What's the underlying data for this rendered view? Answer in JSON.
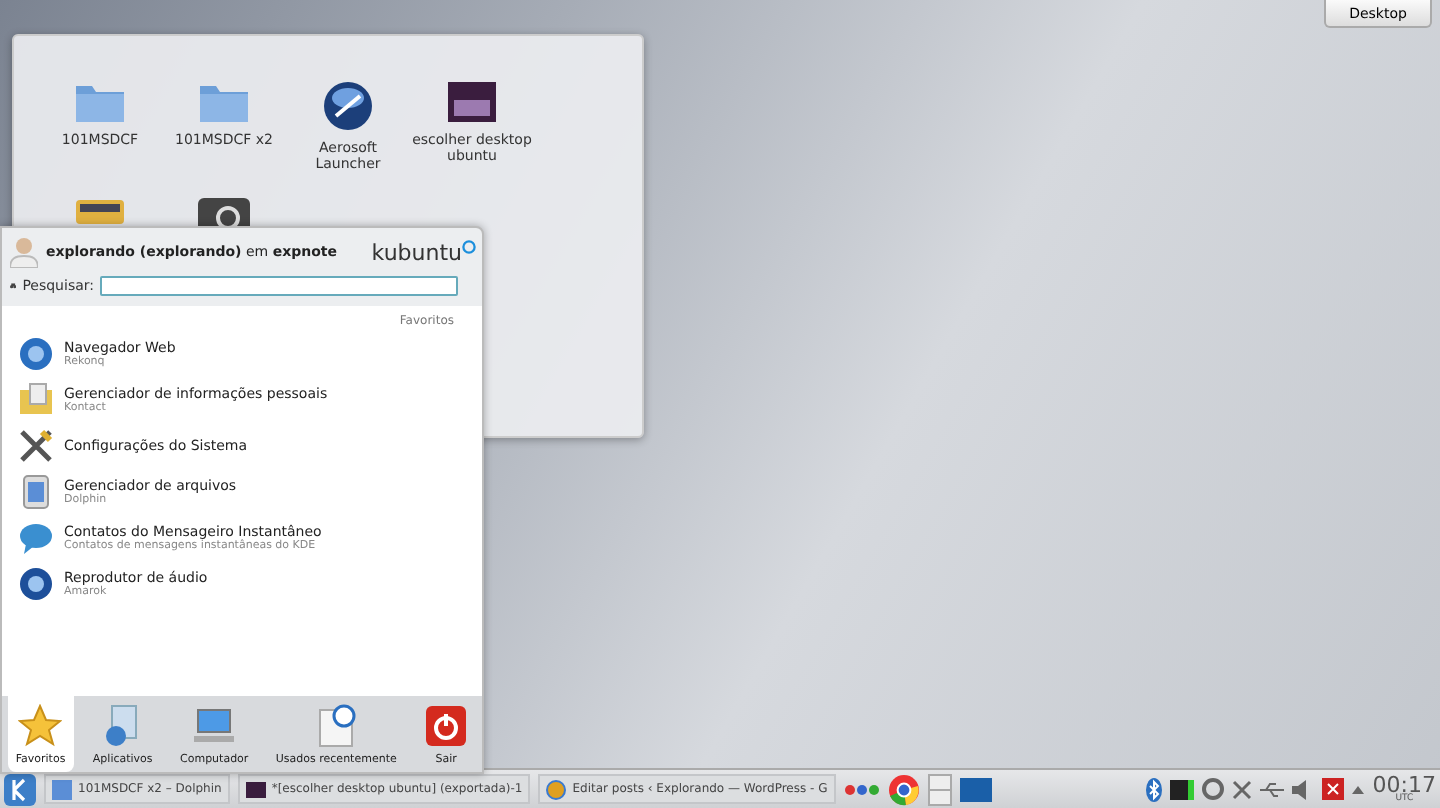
{
  "desktop_button": "Desktop",
  "desktop_icons": [
    {
      "label": "101MSDCF",
      "kind": "folder"
    },
    {
      "label": "101MSDCF x2",
      "kind": "folder"
    },
    {
      "label": "Aerosoft Launcher",
      "kind": "app"
    },
    {
      "label": "escolher desktop ubuntu",
      "kind": "image"
    }
  ],
  "menu": {
    "user": "explorando (explorando)",
    "user_suffix": "em",
    "host": "expnote",
    "brand": "kubuntu",
    "search_label": "Pesquisar:",
    "section": "Favoritos",
    "items": [
      {
        "name": "Navegador Web",
        "subtitle": "Rekonq",
        "kind": "web"
      },
      {
        "name": "Gerenciador de informações pessoais",
        "subtitle": "Kontact",
        "kind": "pim"
      },
      {
        "name": "Configurações do Sistema",
        "kind": "settings"
      },
      {
        "name": "Gerenciador de arquivos",
        "subtitle": "Dolphin",
        "kind": "files"
      },
      {
        "name": "Contatos do Mensageiro Instantâneo",
        "subtitle": "Contatos de mensagens instantâneas do KDE",
        "kind": "chat"
      },
      {
        "name": "Reprodutor de áudio",
        "subtitle": "Amarok",
        "kind": "audio"
      }
    ],
    "tabs": [
      {
        "label": "Favoritos",
        "kind": "star",
        "selected": true
      },
      {
        "label": "Aplicativos",
        "kind": "apps",
        "selected": false
      },
      {
        "label": "Computador",
        "kind": "computer",
        "selected": false
      },
      {
        "label": "Usados recentemente",
        "kind": "recent",
        "selected": false
      },
      {
        "label": "Sair",
        "kind": "power",
        "selected": false
      }
    ]
  },
  "taskbar": {
    "tasks": [
      {
        "label": "101MSDCF x2 – Dolphin",
        "kind": "files"
      },
      {
        "label": "*[escolher desktop ubuntu] (exportada)-1",
        "kind": "image"
      },
      {
        "label": "Editar posts ‹ Explorando — WordPress - G",
        "kind": "browser"
      }
    ],
    "clock": "00:17",
    "timezone": "UTC"
  }
}
